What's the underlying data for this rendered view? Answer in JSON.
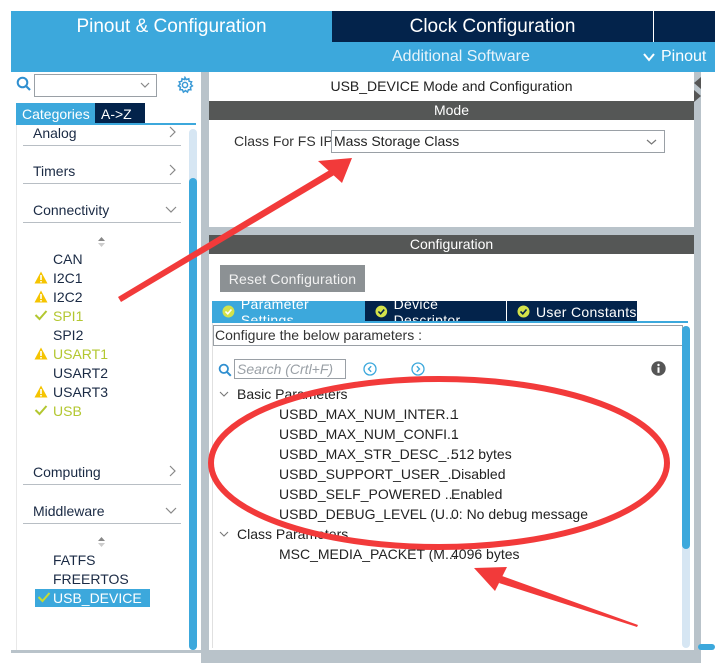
{
  "main_tabs": [
    {
      "label": "Pinout & Configuration",
      "active": true
    },
    {
      "label": "Clock Configuration",
      "active": false
    }
  ],
  "subbar": {
    "additional_software": "Additional Software",
    "pinout_menu": "Pinout"
  },
  "left_panel": {
    "search_value": "",
    "tabs": [
      {
        "label": "Categories",
        "active": true
      },
      {
        "label": "A->Z",
        "active": false
      }
    ],
    "categories": [
      {
        "label": "Analog",
        "expanded": false
      },
      {
        "label": "Timers",
        "expanded": false
      },
      {
        "label": "Connectivity",
        "expanded": true
      },
      {
        "label": "Computing",
        "expanded": false
      },
      {
        "label": "Middleware",
        "expanded": true
      }
    ],
    "connectivity_items": [
      {
        "label": "CAN",
        "status": "none"
      },
      {
        "label": "I2C1",
        "status": "warning"
      },
      {
        "label": "I2C2",
        "status": "warning"
      },
      {
        "label": "SPI1",
        "status": "ok"
      },
      {
        "label": "SPI2",
        "status": "none"
      },
      {
        "label": "USART1",
        "status": "warning-ok"
      },
      {
        "label": "USART2",
        "status": "none"
      },
      {
        "label": "USART3",
        "status": "warning"
      },
      {
        "label": "USB",
        "status": "ok"
      }
    ],
    "middleware_items": [
      {
        "label": "FATFS",
        "status": "none"
      },
      {
        "label": "FREERTOS",
        "status": "none"
      },
      {
        "label": "USB_DEVICE",
        "status": "ok",
        "selected": true
      }
    ]
  },
  "mode_panel": {
    "title": "USB_DEVICE Mode and Configuration",
    "mode_header": "Mode",
    "class_label": "Class For FS IP",
    "class_value": "Mass Storage Class"
  },
  "config_panel": {
    "header": "Configuration",
    "reset_button": "Reset Configuration",
    "tabs": [
      {
        "label": "Parameter Settings",
        "active": true
      },
      {
        "label": "Device Descriptor",
        "active": false
      },
      {
        "label": "User Constants",
        "active": false
      }
    ],
    "hint": "Configure the below parameters :",
    "search_placeholder": "Search (Crtl+F)",
    "groups": [
      {
        "label": "Basic Parameters",
        "params": [
          {
            "name": "USBD_MAX_NUM_INTER...",
            "value": "1"
          },
          {
            "name": "USBD_MAX_NUM_CONFI...",
            "value": "1"
          },
          {
            "name": "USBD_MAX_STR_DESC_...",
            "value": "512 bytes"
          },
          {
            "name": "USBD_SUPPORT_USER_...",
            "value": "Disabled"
          },
          {
            "name": "USBD_SELF_POWERED ...",
            "value": "Enabled"
          },
          {
            "name": "USBD_DEBUG_LEVEL (U...",
            "value": "0: No debug message"
          }
        ]
      },
      {
        "label": "Class Parameters",
        "params": [
          {
            "name": "MSC_MEDIA_PACKET (M...",
            "value": "4096 bytes"
          }
        ]
      }
    ]
  },
  "colors": {
    "accent": "#3ca8dc",
    "navy": "#03234b",
    "ok": "#b3c730",
    "warning": "#f5c400",
    "annotation": "#f23a3a"
  }
}
